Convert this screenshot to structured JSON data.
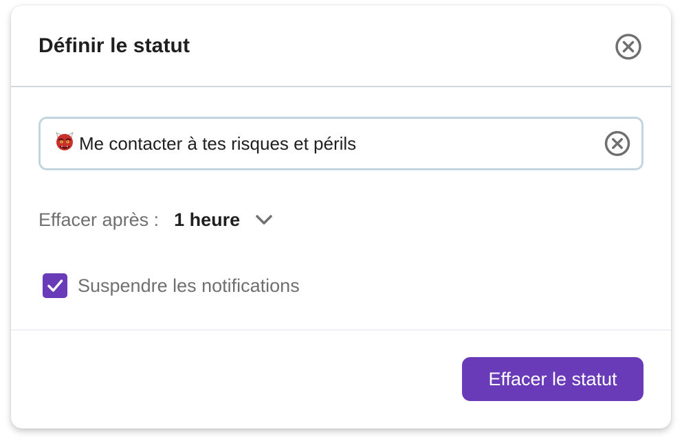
{
  "dialog": {
    "title": "Définir le statut"
  },
  "status": {
    "emoji": "ogre-face",
    "text": "Me contacter à tes risques et périls"
  },
  "clear_after": {
    "label": "Effacer après :",
    "value": "1 heure"
  },
  "notifications": {
    "label": "Suspendre les notifications",
    "checked": true
  },
  "footer": {
    "clear_button_label": "Effacer le statut"
  },
  "colors": {
    "accent": "#6a3bb9",
    "input_border": "#c1d5e0",
    "icon_gray": "#6f6f6f"
  },
  "icons": {
    "close": "close-circle-icon",
    "clear": "clear-circle-icon",
    "chevron": "chevron-down-icon",
    "check": "checkmark-icon"
  }
}
